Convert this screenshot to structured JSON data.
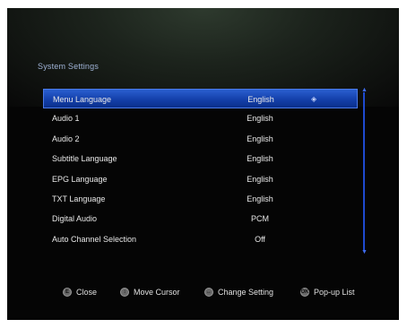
{
  "title": "System Settings",
  "settings": [
    {
      "label": "Menu Language",
      "value": "English"
    },
    {
      "label": "Audio 1",
      "value": "English"
    },
    {
      "label": "Audio 2",
      "value": "English"
    },
    {
      "label": "Subtitle Language",
      "value": "English"
    },
    {
      "label": "EPG Language",
      "value": "English"
    },
    {
      "label": "TXT Language",
      "value": "English"
    },
    {
      "label": "Digital Audio",
      "value": "PCM"
    },
    {
      "label": "Auto Channel Selection",
      "value": "Off"
    }
  ],
  "selected_index": 0,
  "footer": {
    "close": "Close",
    "move_cursor": "Move Cursor",
    "change_setting": "Change Setting",
    "popup_list": "Pop-up List"
  },
  "icons": {
    "close": "exit-button-icon",
    "move_cursor": "arrow-keys-icon",
    "change_setting": "left-right-keys-icon",
    "popup_list": "ok-button-icon",
    "selected_marker": "updown-arrow-icon"
  },
  "colors": {
    "selection": "#1440aa",
    "title": "#9fb3d6",
    "scrollbar": "#1e4ad0"
  }
}
